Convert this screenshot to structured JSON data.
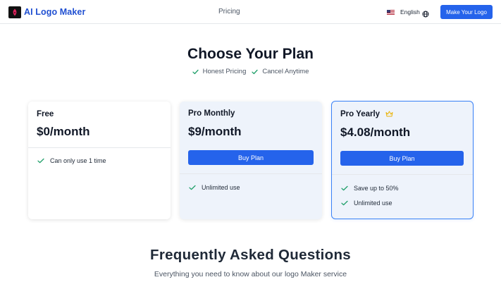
{
  "header": {
    "brand_name": "AI Logo Maker",
    "nav_pricing": "Pricing",
    "language": "English",
    "cta_label": "Make Your Logo"
  },
  "hero": {
    "title": "Choose Your Plan",
    "badges": [
      "Honest Pricing",
      "Cancel Anytime"
    ]
  },
  "plans": [
    {
      "name": "Free",
      "price": "$0/month",
      "button_label": "",
      "features": [
        "Can only use 1 time"
      ]
    },
    {
      "name": "Pro Monthly",
      "price": "$9/month",
      "button_label": "Buy Plan",
      "features": [
        "Unlimited use"
      ]
    },
    {
      "name": "Pro Yearly",
      "price": "$4.08/month",
      "button_label": "Buy Plan",
      "features": [
        "Save up to 50%",
        "Unlimited use"
      ],
      "highlighted": true,
      "icon": "crown-icon"
    }
  ],
  "faq": {
    "title": "Frequently Asked Questions",
    "subtitle": "Everything you need to know about our logo Maker service"
  },
  "colors": {
    "primary": "#2563eb",
    "brand_text": "#1f4fd1",
    "check": "#22a06b",
    "crown": "#eab308",
    "highlight_border": "#3b82f6"
  }
}
